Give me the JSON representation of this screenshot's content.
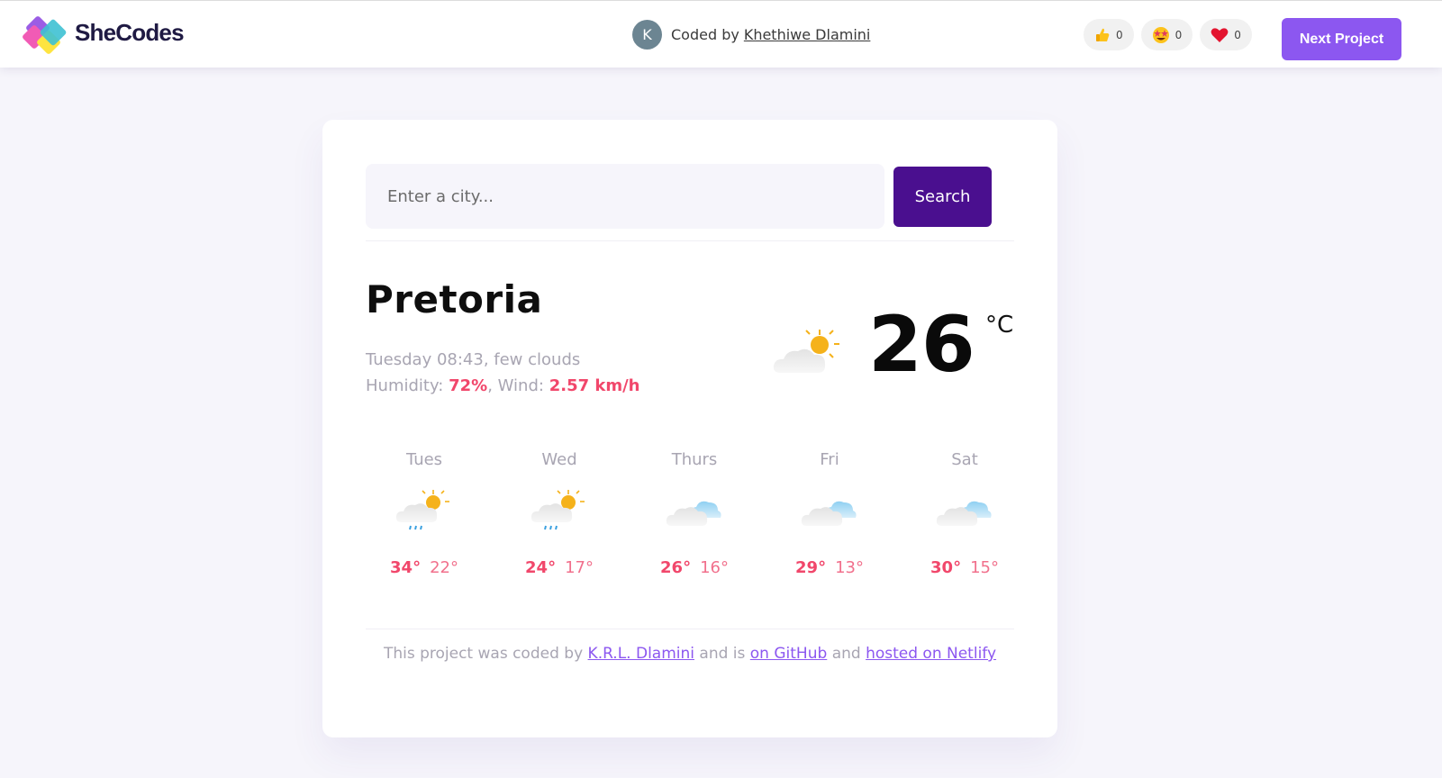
{
  "header": {
    "brand": "SheCodes",
    "avatar_initial": "K",
    "coded_by_prefix": "Coded by",
    "author": "Khethiwe Dlamini",
    "reactions": [
      {
        "icon": "thumbs-up-icon",
        "count": "0"
      },
      {
        "icon": "star-struck-icon",
        "count": "0"
      },
      {
        "icon": "heart-icon",
        "count": "0"
      }
    ],
    "next_button": "Next Project"
  },
  "search": {
    "placeholder": "Enter a city...",
    "button": "Search"
  },
  "current": {
    "city": "Pretoria",
    "description": "Tuesday 08:43, few clouds",
    "humidity_label": "Humidity:",
    "humidity": "72%",
    "wind_label": "Wind:",
    "wind": "2.57 km/h",
    "temperature": "26",
    "unit": "°C",
    "icon": "partly-sunny-icon"
  },
  "forecast": [
    {
      "day": "Tues",
      "max": "34°",
      "min": "22°",
      "icon": "sun-rain-icon"
    },
    {
      "day": "Wed",
      "max": "24°",
      "min": "17°",
      "icon": "sun-rain-icon"
    },
    {
      "day": "Thurs",
      "max": "26°",
      "min": "16°",
      "icon": "cloud-icon"
    },
    {
      "day": "Fri",
      "max": "29°",
      "min": "13°",
      "icon": "cloud-icon"
    },
    {
      "day": "Sat",
      "max": "30°",
      "min": "15°",
      "icon": "cloud-icon"
    }
  ],
  "footer": {
    "prefix": "This project was coded by",
    "author_link": "K.R.L. Dlamini",
    "middle": "and is",
    "github_link": "on GitHub",
    "and": "and",
    "netlify_link": "hosted on Netlify"
  },
  "colors": {
    "accent": "#8c57f0",
    "search_button": "#4a0f8f",
    "highlight": "#f1476b",
    "muted_text": "#a8a5b2"
  }
}
